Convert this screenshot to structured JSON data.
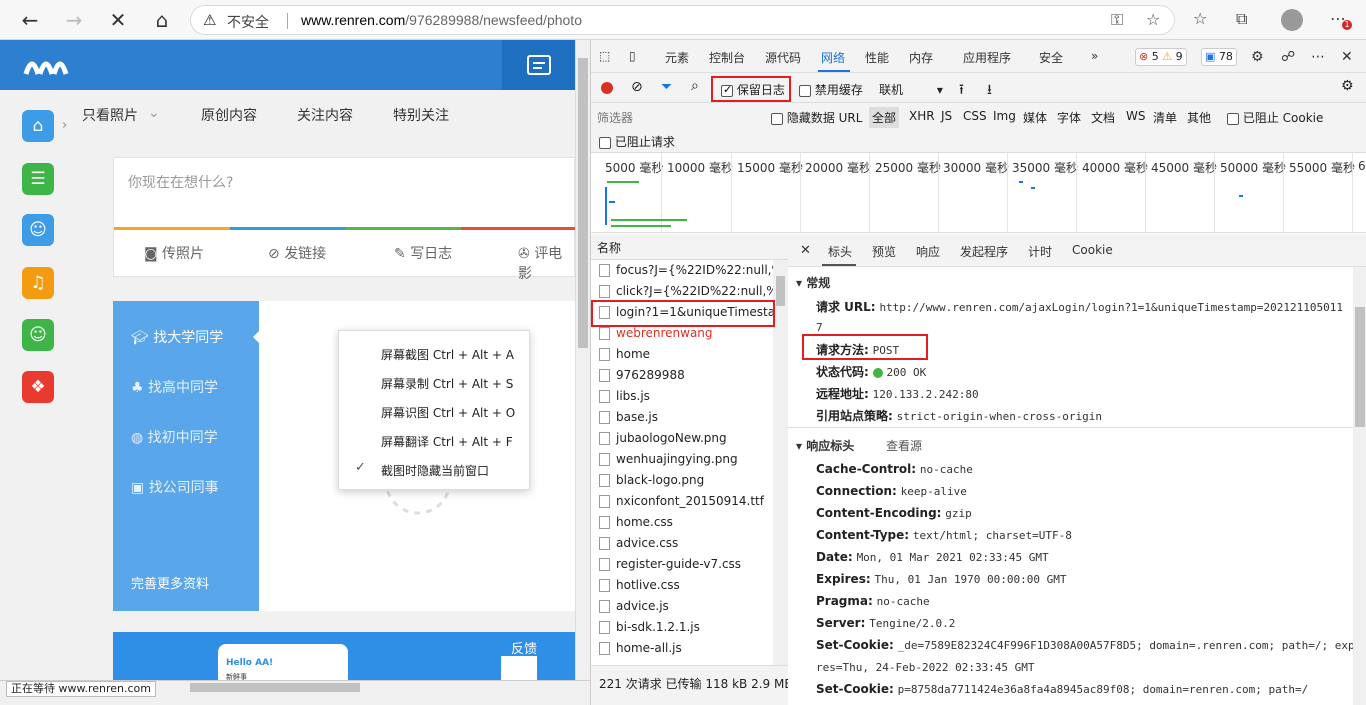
{
  "browser": {
    "address_warning": "不安全",
    "url_domain": "www.renren.com",
    "url_path": "/976289988/newsfeed/photo"
  },
  "page": {
    "tabs": [
      "只看照片",
      "原创内容",
      "关注内容",
      "特别关注"
    ],
    "status_placeholder": "你现在在想什么?",
    "post_buttons": [
      "传照片",
      "发链接",
      "写日志",
      "评电影"
    ],
    "find_items": [
      "找大学同学",
      "找高中同学",
      "找初中同学",
      "找公司同事"
    ],
    "complete_profile": "完善更多资料",
    "banner_text": "Hello AA!",
    "banner_sub": "新鲜事",
    "feedback": "反馈",
    "colorbar": [
      "#f5a623",
      "#2d9fd8",
      "#57b648",
      "#e94b3c"
    ]
  },
  "context_menu": {
    "items": [
      "屏幕截图 Ctrl + Alt + A",
      "屏幕录制 Ctrl + Alt + S",
      "屏幕识图 Ctrl + Alt + O",
      "屏幕翻译 Ctrl + Alt + F",
      "截图时隐藏当前窗口"
    ]
  },
  "statusbar": {
    "text": "正在等待 www.renren.com"
  },
  "devtools": {
    "tabs": [
      "元素",
      "控制台",
      "源代码",
      "网络",
      "性能",
      "内存",
      "应用程序",
      "安全"
    ],
    "active_tab": "网络",
    "errors": "5",
    "warnings": "9",
    "messages": "78",
    "toolbar": {
      "preserve_log": "保留日志",
      "disable_cache": "禁用缓存",
      "throttle": "联机"
    },
    "filter": {
      "placeholder": "筛选器",
      "hide_data_url": "隐藏数据 URL",
      "types": [
        "全部",
        "XHR",
        "JS",
        "CSS",
        "Img",
        "媒体",
        "字体",
        "文档",
        "WS",
        "清单",
        "其他"
      ],
      "blocked_cookie": "已阻止 Cookie",
      "blocked_requests": "已阻止请求"
    },
    "timeline_labels": [
      "5000 毫秒",
      "10000 毫秒",
      "15000 毫秒",
      "20000 毫秒",
      "25000 毫秒",
      "30000 毫秒",
      "35000 毫秒",
      "40000 毫秒",
      "45000 毫秒",
      "50000 毫秒",
      "55000 毫秒",
      "6"
    ],
    "name_header": "名称",
    "requests": [
      "focus?J={%22ID%22:null,%22...",
      "click?J={%22ID%22:null,%22R...",
      "login?1=1&uniqueTimestamp...",
      "webrenrenwang",
      "home",
      "976289988",
      "libs.js",
      "base.js",
      "jubaologoNew.png",
      "wenhuajingying.png",
      "black-logo.png",
      "nxiconfont_20150914.ttf",
      "home.css",
      "advice.css",
      "register-guide-v7.css",
      "hotlive.css",
      "advice.js",
      "bi-sdk.1.2.1.js",
      "home-all.js"
    ],
    "summary": "221 次请求  已传输 118 kB  2.9 MB",
    "detail_tabs": [
      "标头",
      "预览",
      "响应",
      "发起程序",
      "计时",
      "Cookie"
    ],
    "general": {
      "title": "常规",
      "request_url_k": "请求 URL:",
      "request_url_v": "http://www.renren.com/ajaxLogin/login?1=1&uniqueTimestamp=202121105011",
      "request_url_cont": "7",
      "method_k": "请求方法:",
      "method_v": "POST",
      "status_k": "状态代码:",
      "status_v": "200 OK",
      "remote_k": "远程地址:",
      "remote_v": "120.133.2.242:80",
      "referrer_k": "引用站点策略:",
      "referrer_v": "strict-origin-when-cross-origin"
    },
    "response_headers": {
      "title": "响应标头",
      "view_source": "查看源",
      "rows": [
        {
          "k": "Cache-Control:",
          "v": "no-cache"
        },
        {
          "k": "Connection:",
          "v": "keep-alive"
        },
        {
          "k": "Content-Encoding:",
          "v": "gzip"
        },
        {
          "k": "Content-Type:",
          "v": "text/html; charset=UTF-8"
        },
        {
          "k": "Date:",
          "v": "Mon, 01 Mar 2021 02:33:45 GMT"
        },
        {
          "k": "Expires:",
          "v": "Thu, 01 Jan 1970 00:00:00 GMT"
        },
        {
          "k": "Pragma:",
          "v": "no-cache"
        },
        {
          "k": "Server:",
          "v": "Tengine/2.0.2"
        },
        {
          "k": "Set-Cookie:",
          "v": "_de=7589E82324C4F996F1D308A00A57F8D5; domain=.renren.com; path=/; expi"
        },
        {
          "k": "",
          "v": "res=Thu, 24-Feb-2022 02:33:45 GMT"
        },
        {
          "k": "Set-Cookie:",
          "v": "p=8758da7711424e36a8fa4a8945ac89f08; domain=renren.com; path=/"
        }
      ]
    }
  }
}
